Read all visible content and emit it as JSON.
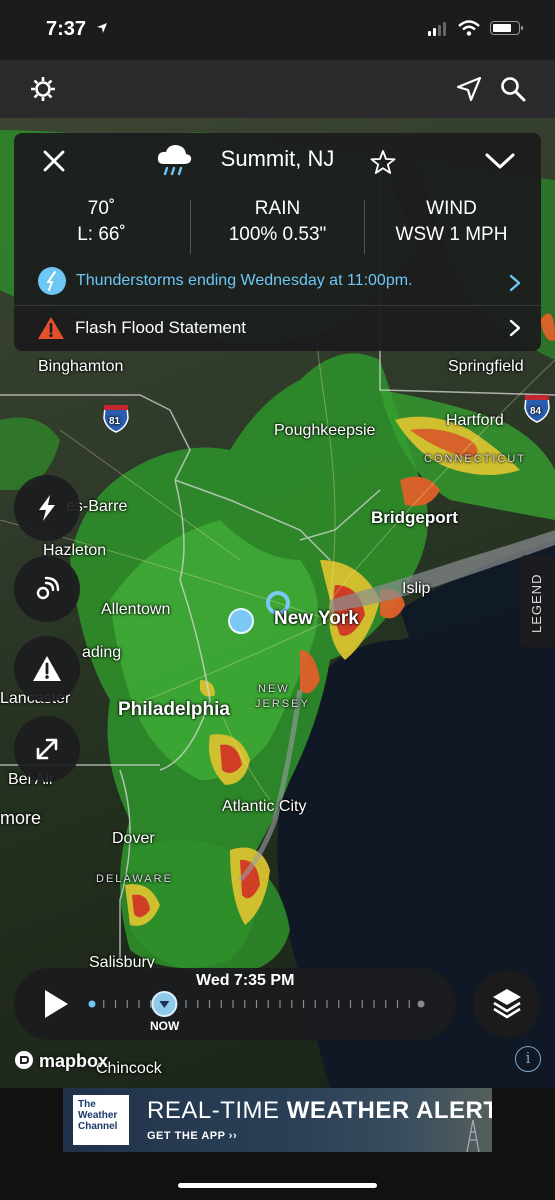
{
  "status_bar": {
    "time": "7:37"
  },
  "map": {
    "labels": {
      "binghamton": "Binghamton",
      "springfield": "Springfield",
      "hartford": "Hartford",
      "poughkeepsie": "Poughkeepsie",
      "connecticut": "CONNECTICUT",
      "wilkes_barre": "es-Barre",
      "bridgeport": "Bridgeport",
      "hazleton": "Hazleton",
      "islip": "Islip",
      "allentown": "Allentown",
      "new_york": "New York",
      "reading": "ading",
      "new_jersey_1": "NEW",
      "new_jersey_2": "JERSEY",
      "lancaster": "Lancaster",
      "philadelphia": "Philadelphia",
      "bel_air": "Bel Air",
      "atlantic_city": "Atlantic City",
      "baltimore": "more",
      "dover": "Dover",
      "delaware": "DELAWARE",
      "salisbury": "Salisbury",
      "chincoteague": "Chincock",
      "interstate_81": "81",
      "interstate_84": "84"
    }
  },
  "card": {
    "location": "Summit, NJ",
    "temp_high": "70˚",
    "temp_low": "L: 66˚",
    "precip_title": "RAIN",
    "precip_value": "100% 0.53\"",
    "wind_title": "WIND",
    "wind_value": "WSW 1 MPH",
    "forecast": "Thunderstorms ending Wednesday at 11:00pm.",
    "alert": "Flash Flood Statement"
  },
  "legend_label": "LEGEND",
  "timeline": {
    "time": "Wed 7:35 PM",
    "now_label": "NOW",
    "position_fraction": 0.22
  },
  "attribution": "mapbox",
  "ad": {
    "logo_line1": "The",
    "logo_line2": "Weather",
    "logo_line3": "Channel",
    "headline_light": "REAL-TIME ",
    "headline_bold": "WEATHER ALERTS",
    "cta": "GET THE APP ››"
  },
  "colors": {
    "accent_blue": "#6ec6f5",
    "alert_red": "#e5502b",
    "radar_green": "#3da832"
  }
}
